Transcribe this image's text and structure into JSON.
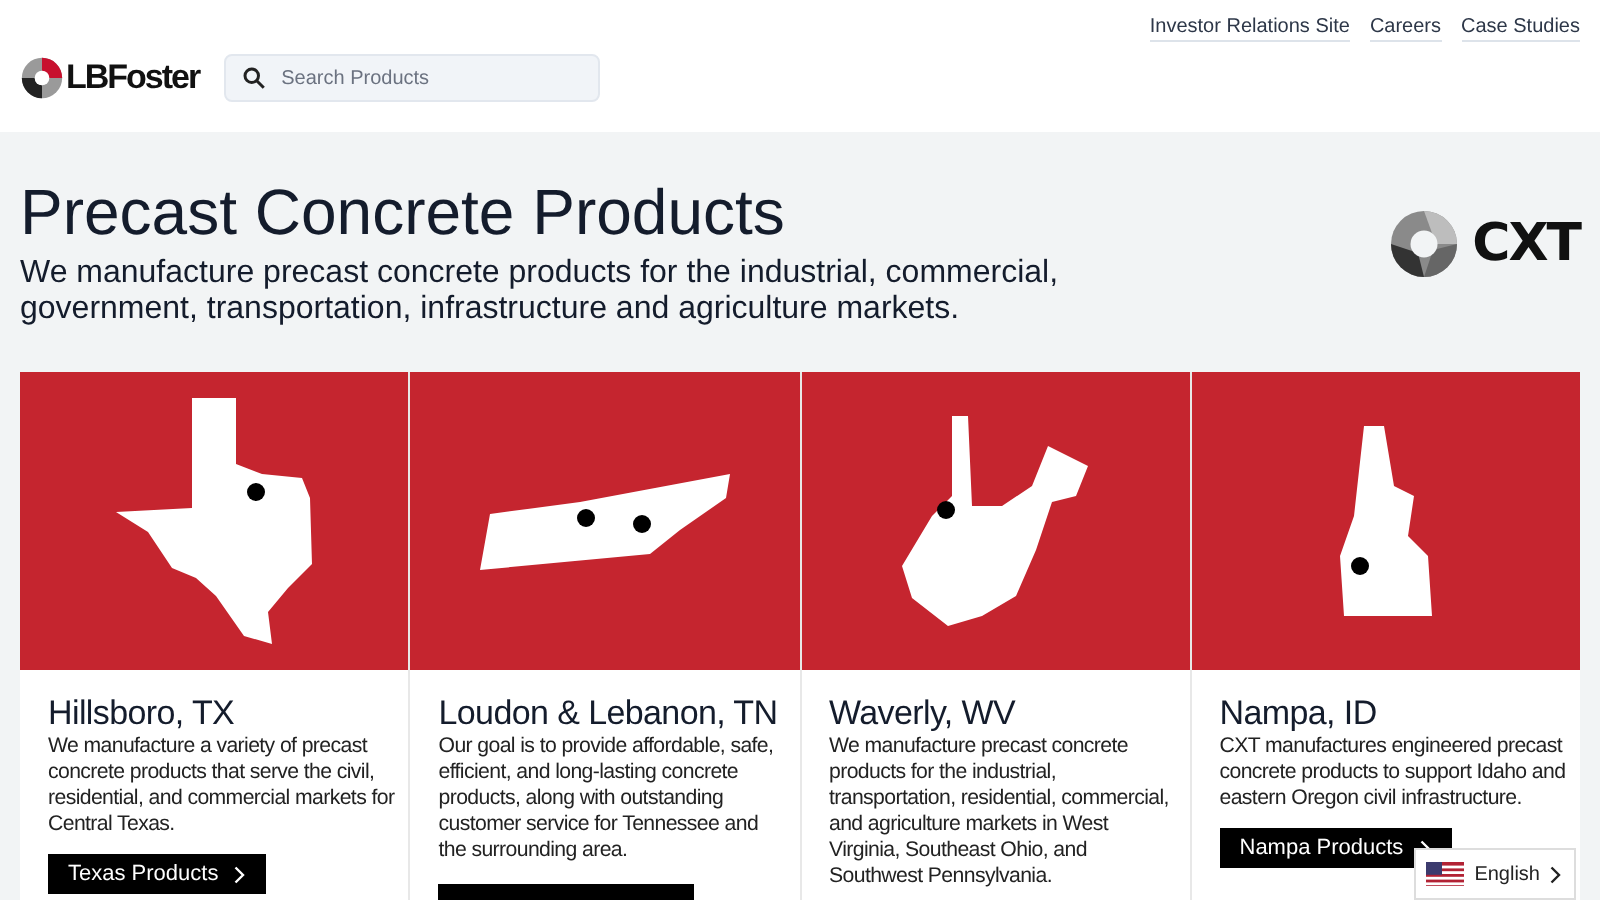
{
  "header": {
    "logo": "LBFoster",
    "search": {
      "placeholder": "Search Products"
    },
    "links": [
      "Investor Relations Site",
      "Careers",
      "Case Studies"
    ]
  },
  "hero": {
    "title": "Precast Concrete Products",
    "subtitle": "We manufacture precast concrete products for the industrial, commercial, government, transportation, infrastructure and agriculture markets.",
    "brand": "CXT"
  },
  "cards": [
    {
      "title": "Hillsboro, TX",
      "text": "We manufacture a variety of precast concrete products that serve the civil, residential, and commercial markets for Central Texas.",
      "button": {
        "label": "Texas Products"
      }
    },
    {
      "title": "Loudon & Lebanon, TN",
      "text": "Our goal is to provide affordable, safe, efficient, and long-lasting concrete products, along with outstanding customer service for Tennessee and the surrounding area.",
      "button": {
        "visible": true
      }
    },
    {
      "title": "Waverly, WV",
      "text": "We manufacture precast concrete products for the industrial, transportation, residential, commercial, and agriculture markets in West Virginia, Southeast Ohio, and Southwest Pennsylvania."
    },
    {
      "title": "Nampa, ID",
      "text": "CXT manufactures engineered precast concrete products to support Idaho and eastern Oregon civil infrastructure.",
      "button": {
        "label": "Nampa Products"
      }
    }
  ],
  "language": {
    "label": "English"
  }
}
